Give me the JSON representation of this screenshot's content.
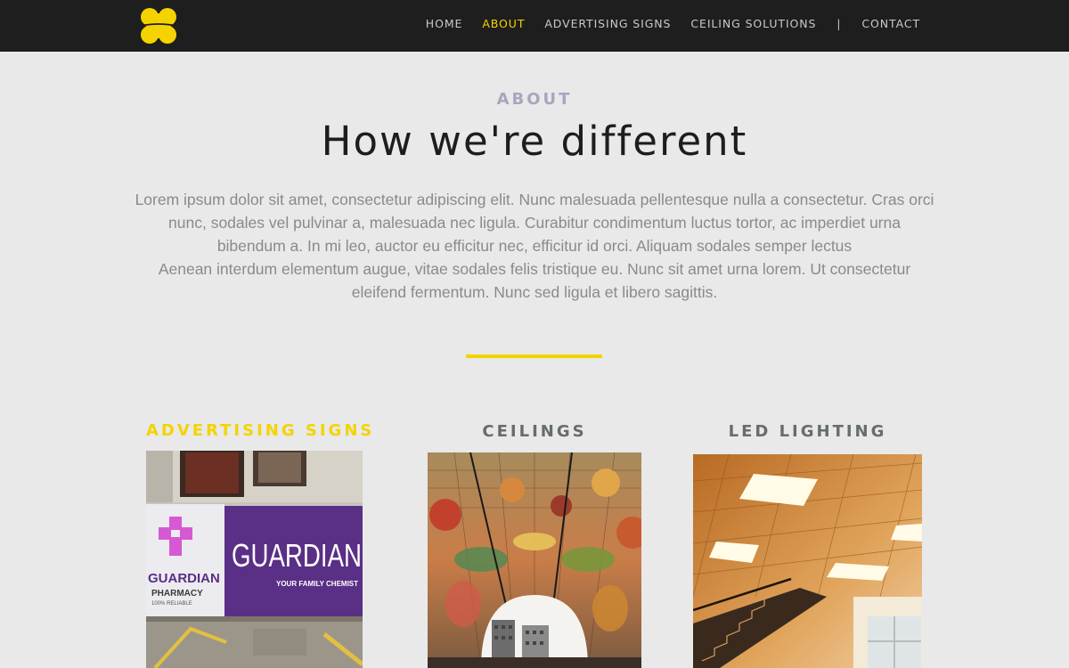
{
  "nav": {
    "items": [
      "HOME",
      "ABOUT",
      "ADVERTISING SIGNS",
      "CEILING SOLUTIONS"
    ],
    "active": "ABOUT",
    "separator": "|",
    "contact": "CONTACT"
  },
  "hero": {
    "eyebrow": "ABOUT",
    "headline": "How we're different",
    "body": [
      "Lorem ipsum dolor sit amet, consectetur adipiscing elit. Nunc malesuada pellentesque nulla a consectetur. Cras orci nunc, sodales vel pulvinar a, malesuada nec ligula. Curabitur condimentum luctus tortor, ac imperdiet urna bibendum a. In mi leo, auctor eu efficitur nec, efficitur id orci. Aliquam sodales semper lectus",
      "Aenean interdum elementum augue, vitae sodales felis tristique eu. Nunc sit amet urna lorem. Ut consectetur eleifend fermentum. Nunc sed ligula et libero sagittis."
    ]
  },
  "cards": [
    {
      "title": "ADVERTISING SIGNS",
      "image": {
        "brand": "GUARDIAN",
        "tagline": "YOUR FAMILY CHEMIST",
        "logo_text": "GUARDIAN",
        "sub1": "PHARMACY",
        "sub2": "100% RELIABLE"
      }
    },
    {
      "title": "CEILINGS"
    },
    {
      "title": "LED LIGHTING"
    }
  ],
  "colors": {
    "accent": "#f5d300",
    "nav_bg": "#1e1e1e",
    "page_bg": "#e8e9e8"
  }
}
